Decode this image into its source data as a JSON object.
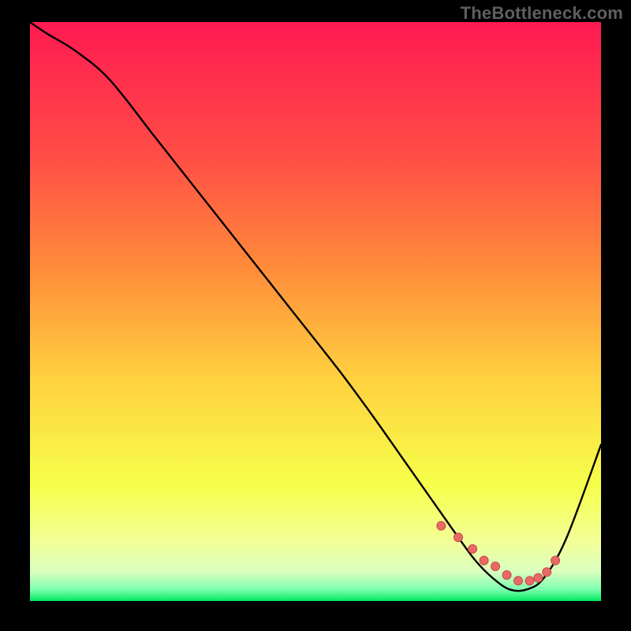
{
  "watermark": "TheBottleneck.com",
  "colors": {
    "page_background": "#000000",
    "gradient_top": "#ff1a52",
    "gradient_mid_upper": "#ff6a3d",
    "gradient_mid": "#ffd23f",
    "gradient_lower": "#f6ff4a",
    "gradient_near_bottom": "#e8ffb0",
    "gradient_bottom": "#00e860",
    "curve_stroke": "#000000",
    "marker_fill": "#e86a66",
    "marker_stroke": "#c94b47"
  },
  "chart_data": {
    "type": "line",
    "title": "",
    "xlabel": "",
    "ylabel": "",
    "xlim": [
      0,
      100
    ],
    "ylim": [
      0,
      100
    ],
    "grid": false,
    "series": [
      {
        "name": "bottleneck-curve",
        "x": [
          0,
          3,
          8,
          14,
          22,
          30,
          38,
          46,
          54,
          60,
          65,
          70,
          75,
          78,
          81,
          84,
          87,
          90,
          94,
          100
        ],
        "y": [
          100,
          98,
          95,
          90,
          80,
          70,
          60,
          50,
          40,
          32,
          25,
          18,
          11,
          7,
          4,
          2,
          2,
          4,
          11,
          27
        ]
      }
    ],
    "markers": {
      "name": "optimal-zone",
      "x": [
        72,
        75,
        77.5,
        79.5,
        81.5,
        83.5,
        85.5,
        87.5,
        89,
        90.5,
        92
      ],
      "y": [
        13,
        11,
        9,
        7,
        6,
        4.5,
        3.5,
        3.5,
        4,
        5,
        7
      ]
    }
  }
}
